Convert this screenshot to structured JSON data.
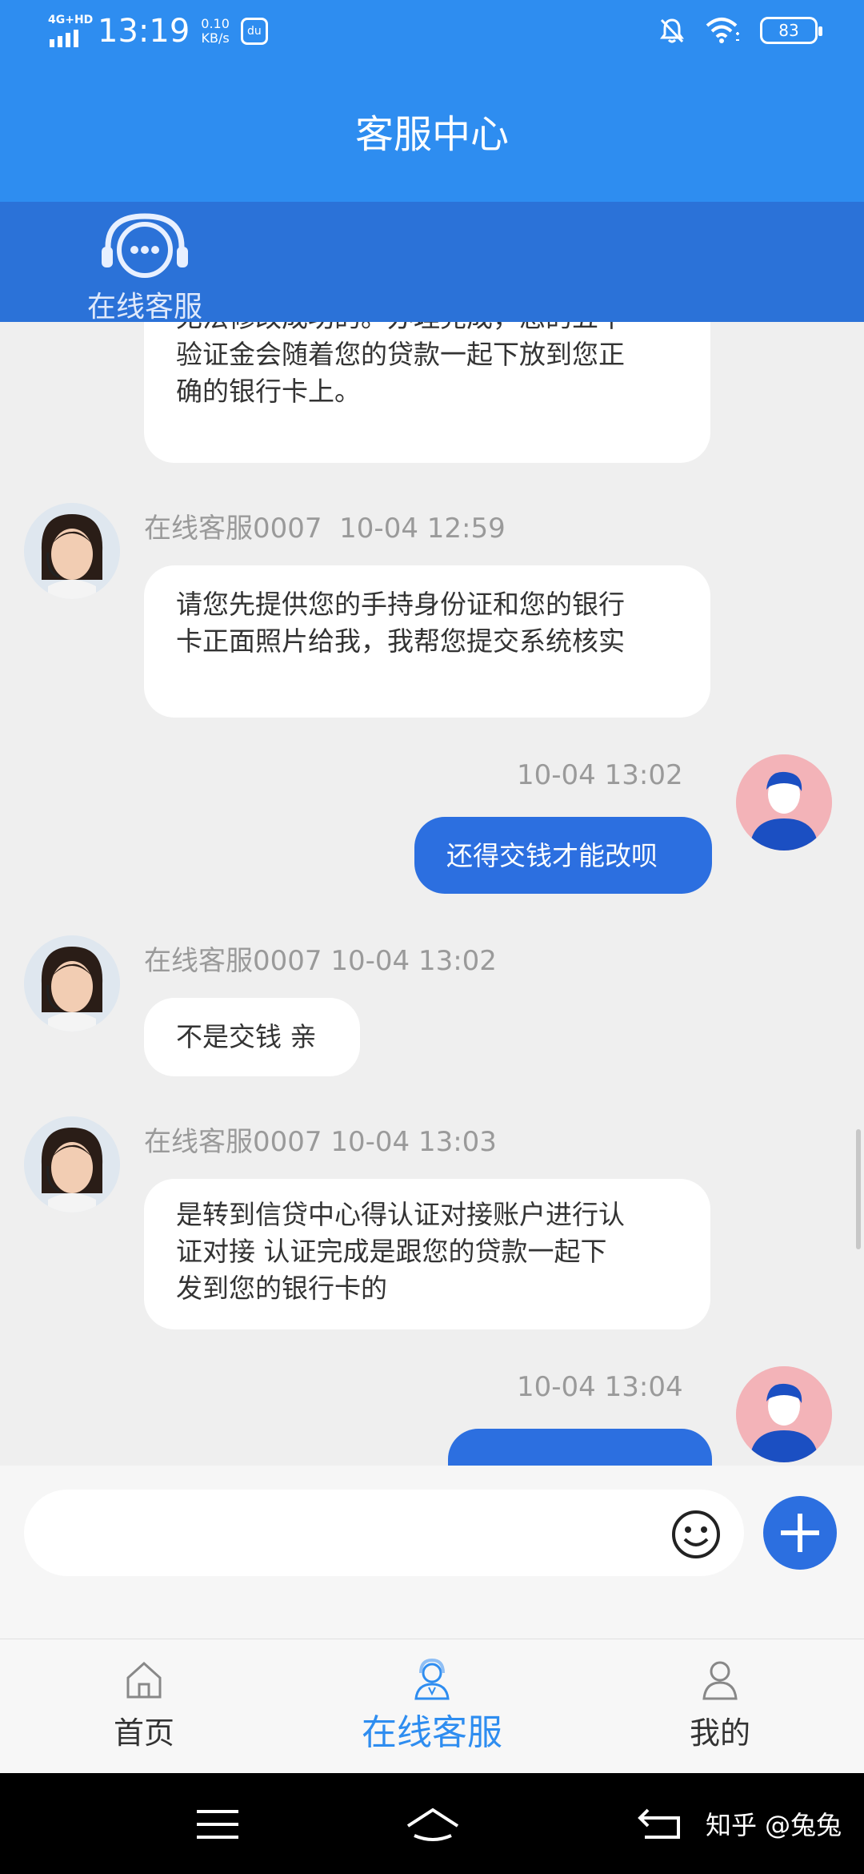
{
  "status_bar": {
    "network": "4G+HD",
    "time": "13:19",
    "speed_value": "0.10",
    "speed_unit": "KB/s",
    "app_badge": "du",
    "battery": "83"
  },
  "header": {
    "title": "客服中心"
  },
  "subheader": {
    "label": "在线客服"
  },
  "chat": {
    "partial_message": {
      "lines": [
        "无法修改成功的。办理完成，您的五千",
        "验证金会随着您的贷款一起下放到您正",
        "确的银行卡上。"
      ]
    },
    "messages": [
      {
        "sender": "在线客服0007",
        "time": "10-04 12:59",
        "lines": [
          "请您先提供您的手持身份证和您的银行",
          "卡正面照片给我，我帮您提交系统核实"
        ]
      },
      {
        "sender": "",
        "time": "10-04 13:02",
        "lines": [
          "还得交钱才能改呗"
        ]
      },
      {
        "sender": "在线客服0007",
        "time": "10-04 13:02",
        "lines": [
          "不是交钱 亲"
        ]
      },
      {
        "sender": "在线客服0007",
        "time": "10-04 13:03",
        "lines": [
          "是转到信贷中心得认证对接账户进行认",
          "证对接 认证完成是跟您的贷款一起下",
          "发到您的银行卡的"
        ]
      },
      {
        "sender": "",
        "time": "10-04 13:04",
        "lines": []
      }
    ]
  },
  "input": {
    "placeholder": ""
  },
  "bottom_nav": {
    "items": [
      {
        "label": "首页",
        "icon": "home-icon"
      },
      {
        "label": "在线客服",
        "icon": "customer-service-icon"
      },
      {
        "label": "我的",
        "icon": "person-icon"
      }
    ]
  },
  "watermark": "知乎 @兔兔",
  "colors": {
    "primary": "#2e8df0",
    "bubble_out": "#2c6fe0",
    "bubble_in": "#ffffff"
  }
}
